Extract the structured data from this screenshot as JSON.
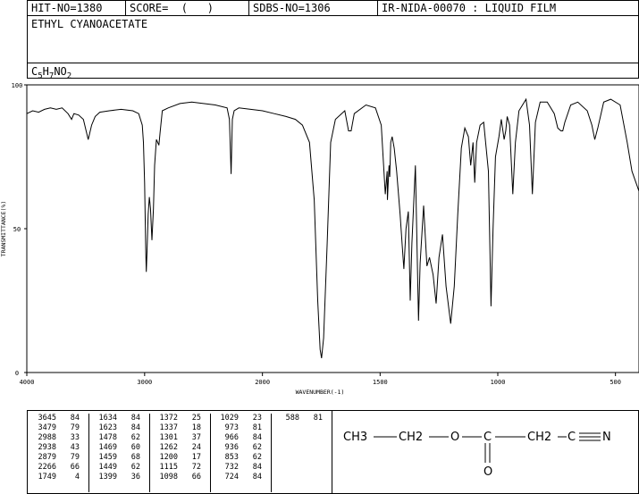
{
  "header": {
    "hit_no": "HIT-NO=1380",
    "score": "SCORE=  (   )",
    "sdbs_no": "SDBS-NO=1306",
    "ir_id": "IR-NIDA-00070 : LIQUID FILM",
    "compound": "ETHYL CYANOACETATE",
    "formula_parts": [
      "C",
      "5",
      "H",
      "7",
      "NO",
      "2"
    ]
  },
  "chart_data": {
    "type": "line",
    "xlabel": "WAVENUMBER(-1)",
    "ylabel": "TRANSMITTANCE(%)",
    "xlim": [
      4000,
      400
    ],
    "ylim": [
      0,
      100
    ],
    "x_ticks": [
      4000,
      3000,
      2000,
      1500,
      1000,
      500
    ],
    "y_ticks": [
      0,
      50,
      100
    ],
    "grid": false,
    "series": [
      {
        "points": [
          [
            4000,
            90
          ],
          [
            3950,
            91
          ],
          [
            3900,
            90.5
          ],
          [
            3850,
            91.5
          ],
          [
            3800,
            92
          ],
          [
            3750,
            91.5
          ],
          [
            3700,
            92
          ],
          [
            3650,
            90
          ],
          [
            3620,
            88
          ],
          [
            3600,
            90
          ],
          [
            3560,
            89.5
          ],
          [
            3520,
            88
          ],
          [
            3479,
            81
          ],
          [
            3450,
            86
          ],
          [
            3420,
            89
          ],
          [
            3380,
            90.5
          ],
          [
            3300,
            91
          ],
          [
            3200,
            91.5
          ],
          [
            3100,
            91
          ],
          [
            3050,
            90
          ],
          [
            3020,
            86
          ],
          [
            3010,
            80
          ],
          [
            3000,
            66
          ],
          [
            2990,
            42
          ],
          [
            2986,
            35
          ],
          [
            2980,
            42
          ],
          [
            2970,
            55
          ],
          [
            2960,
            61
          ],
          [
            2950,
            57
          ],
          [
            2938,
            46
          ],
          [
            2925,
            57
          ],
          [
            2915,
            72
          ],
          [
            2900,
            81
          ],
          [
            2879,
            79
          ],
          [
            2870,
            83
          ],
          [
            2850,
            91
          ],
          [
            2800,
            92
          ],
          [
            2700,
            93.5
          ],
          [
            2600,
            94
          ],
          [
            2500,
            93.5
          ],
          [
            2400,
            93
          ],
          [
            2300,
            92
          ],
          [
            2280,
            88
          ],
          [
            2266,
            69
          ],
          [
            2255,
            88
          ],
          [
            2240,
            91
          ],
          [
            2200,
            92
          ],
          [
            2100,
            91.5
          ],
          [
            2000,
            91
          ],
          [
            1950,
            90
          ],
          [
            1900,
            89
          ],
          [
            1860,
            88
          ],
          [
            1830,
            86
          ],
          [
            1800,
            80
          ],
          [
            1780,
            60
          ],
          [
            1765,
            25
          ],
          [
            1755,
            8
          ],
          [
            1749,
            5
          ],
          [
            1740,
            12
          ],
          [
            1725,
            45
          ],
          [
            1710,
            80
          ],
          [
            1690,
            88
          ],
          [
            1650,
            91
          ],
          [
            1634,
            84
          ],
          [
            1623,
            84
          ],
          [
            1610,
            90
          ],
          [
            1560,
            93
          ],
          [
            1520,
            92
          ],
          [
            1495,
            86
          ],
          [
            1478,
            62
          ],
          [
            1470,
            70
          ],
          [
            1469,
            60
          ],
          [
            1462,
            72
          ],
          [
            1459,
            68
          ],
          [
            1455,
            80
          ],
          [
            1449,
            82
          ],
          [
            1440,
            78
          ],
          [
            1430,
            70
          ],
          [
            1415,
            55
          ],
          [
            1405,
            43
          ],
          [
            1399,
            36
          ],
          [
            1390,
            50
          ],
          [
            1380,
            56
          ],
          [
            1372,
            25
          ],
          [
            1365,
            45
          ],
          [
            1350,
            72
          ],
          [
            1337,
            18
          ],
          [
            1330,
            38
          ],
          [
            1315,
            58
          ],
          [
            1301,
            37
          ],
          [
            1290,
            40
          ],
          [
            1275,
            34
          ],
          [
            1262,
            24
          ],
          [
            1250,
            40
          ],
          [
            1235,
            48
          ],
          [
            1220,
            30
          ],
          [
            1200,
            17
          ],
          [
            1185,
            30
          ],
          [
            1170,
            55
          ],
          [
            1155,
            78
          ],
          [
            1140,
            85
          ],
          [
            1125,
            82
          ],
          [
            1115,
            72
          ],
          [
            1105,
            80
          ],
          [
            1098,
            66
          ],
          [
            1090,
            80
          ],
          [
            1075,
            86
          ],
          [
            1060,
            87
          ],
          [
            1040,
            70
          ],
          [
            1029,
            23
          ],
          [
            1020,
            50
          ],
          [
            1010,
            75
          ],
          [
            995,
            82
          ],
          [
            985,
            88
          ],
          [
            973,
            81
          ],
          [
            966,
            84
          ],
          [
            960,
            89
          ],
          [
            950,
            86
          ],
          [
            936,
            62
          ],
          [
            925,
            80
          ],
          [
            910,
            91
          ],
          [
            880,
            95
          ],
          [
            865,
            86
          ],
          [
            853,
            62
          ],
          [
            840,
            87
          ],
          [
            820,
            94
          ],
          [
            790,
            94
          ],
          [
            760,
            90
          ],
          [
            745,
            85
          ],
          [
            732,
            84
          ],
          [
            724,
            84
          ],
          [
            715,
            87
          ],
          [
            690,
            93
          ],
          [
            660,
            94
          ],
          [
            620,
            91
          ],
          [
            600,
            86
          ],
          [
            588,
            81
          ],
          [
            575,
            85
          ],
          [
            550,
            94
          ],
          [
            520,
            95
          ],
          [
            480,
            93
          ],
          [
            450,
            80
          ],
          [
            430,
            70
          ],
          [
            400,
            63
          ]
        ]
      }
    ]
  },
  "peaks": [
    [
      [
        "3645",
        "84"
      ],
      [
        "3479",
        "79"
      ],
      [
        "2988",
        "33"
      ],
      [
        "2938",
        "43"
      ],
      [
        "2879",
        "79"
      ],
      [
        "2266",
        "66"
      ],
      [
        "1749",
        "4"
      ]
    ],
    [
      [
        "1634",
        "84"
      ],
      [
        "1623",
        "84"
      ],
      [
        "1478",
        "62"
      ],
      [
        "1469",
        "60"
      ],
      [
        "1459",
        "68"
      ],
      [
        "1449",
        "62"
      ],
      [
        "1399",
        "36"
      ]
    ],
    [
      [
        "1372",
        "25"
      ],
      [
        "1337",
        "18"
      ],
      [
        "1301",
        "37"
      ],
      [
        "1262",
        "24"
      ],
      [
        "1200",
        "17"
      ],
      [
        "1115",
        "72"
      ],
      [
        "1098",
        "66"
      ]
    ],
    [
      [
        "1029",
        "23"
      ],
      [
        "973",
        "81"
      ],
      [
        "966",
        "84"
      ],
      [
        "936",
        "62"
      ],
      [
        "853",
        "62"
      ],
      [
        "732",
        "84"
      ],
      [
        "724",
        "84"
      ]
    ],
    [
      [
        "588",
        "81"
      ]
    ]
  ],
  "structure": {
    "atoms": [
      "CH3",
      "CH2",
      "O",
      "C",
      "CH2",
      "C",
      "N",
      "O"
    ]
  }
}
